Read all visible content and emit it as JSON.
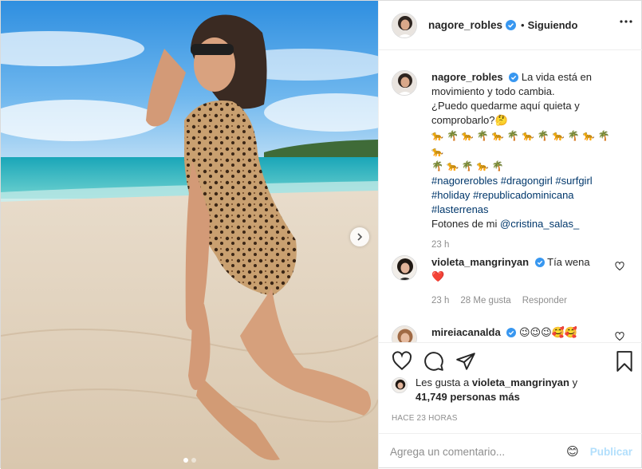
{
  "post": {
    "author": "nagore_robles",
    "follow_status": "Siguiendo",
    "separator": "•",
    "caption": {
      "username": "nagore_robles",
      "line1": "La vida está en movimiento y todo cambia.",
      "line2": "¿Puedo quedarme aquí quieta y comprobarlo?",
      "emoji_rows": [
        [
          "🐆",
          "🌴",
          "🐆",
          "🌴",
          "🐆",
          "🌴",
          "🐆",
          "🌴",
          "🐆",
          "🌴",
          "🐆",
          "🌴",
          "🐆"
        ],
        [
          "🌴",
          "🐆",
          "🌴",
          "🐆",
          "🌴"
        ]
      ],
      "hashtags": [
        "#nagorerobles",
        "#dragongirl",
        "#surfgirl",
        "#holiday",
        "#republicadominicana",
        "#lasterrenas"
      ],
      "credit_prefix": "Fotones de mi",
      "credit_mention": "@cristina_salas_",
      "time": "23 h"
    },
    "comments": [
      {
        "username": "violeta_mangrinyan",
        "text": "Tía wena",
        "emoji": "❤️",
        "time": "23 h",
        "likes": "28 Me gusta",
        "reply": "Responder"
      },
      {
        "username": "mireiacanalda",
        "text": "😉😉😉🥰🥰"
      }
    ],
    "likes": {
      "prefix": "Les gusta a",
      "user": "violeta_mangrinyan",
      "conj": "y",
      "others": "41,749 personas más"
    },
    "timestamp": "HACE 23 HORAS",
    "add_comment": {
      "placeholder": "Agrega un comentario...",
      "emoji_icon": "😊",
      "publish": "Publicar"
    }
  },
  "colors": {
    "verified": "#3897f0",
    "link": "#00376b",
    "muted": "#8e8e8e",
    "publish_disabled": "#b2dffc",
    "heart_red": "#ed4956"
  }
}
